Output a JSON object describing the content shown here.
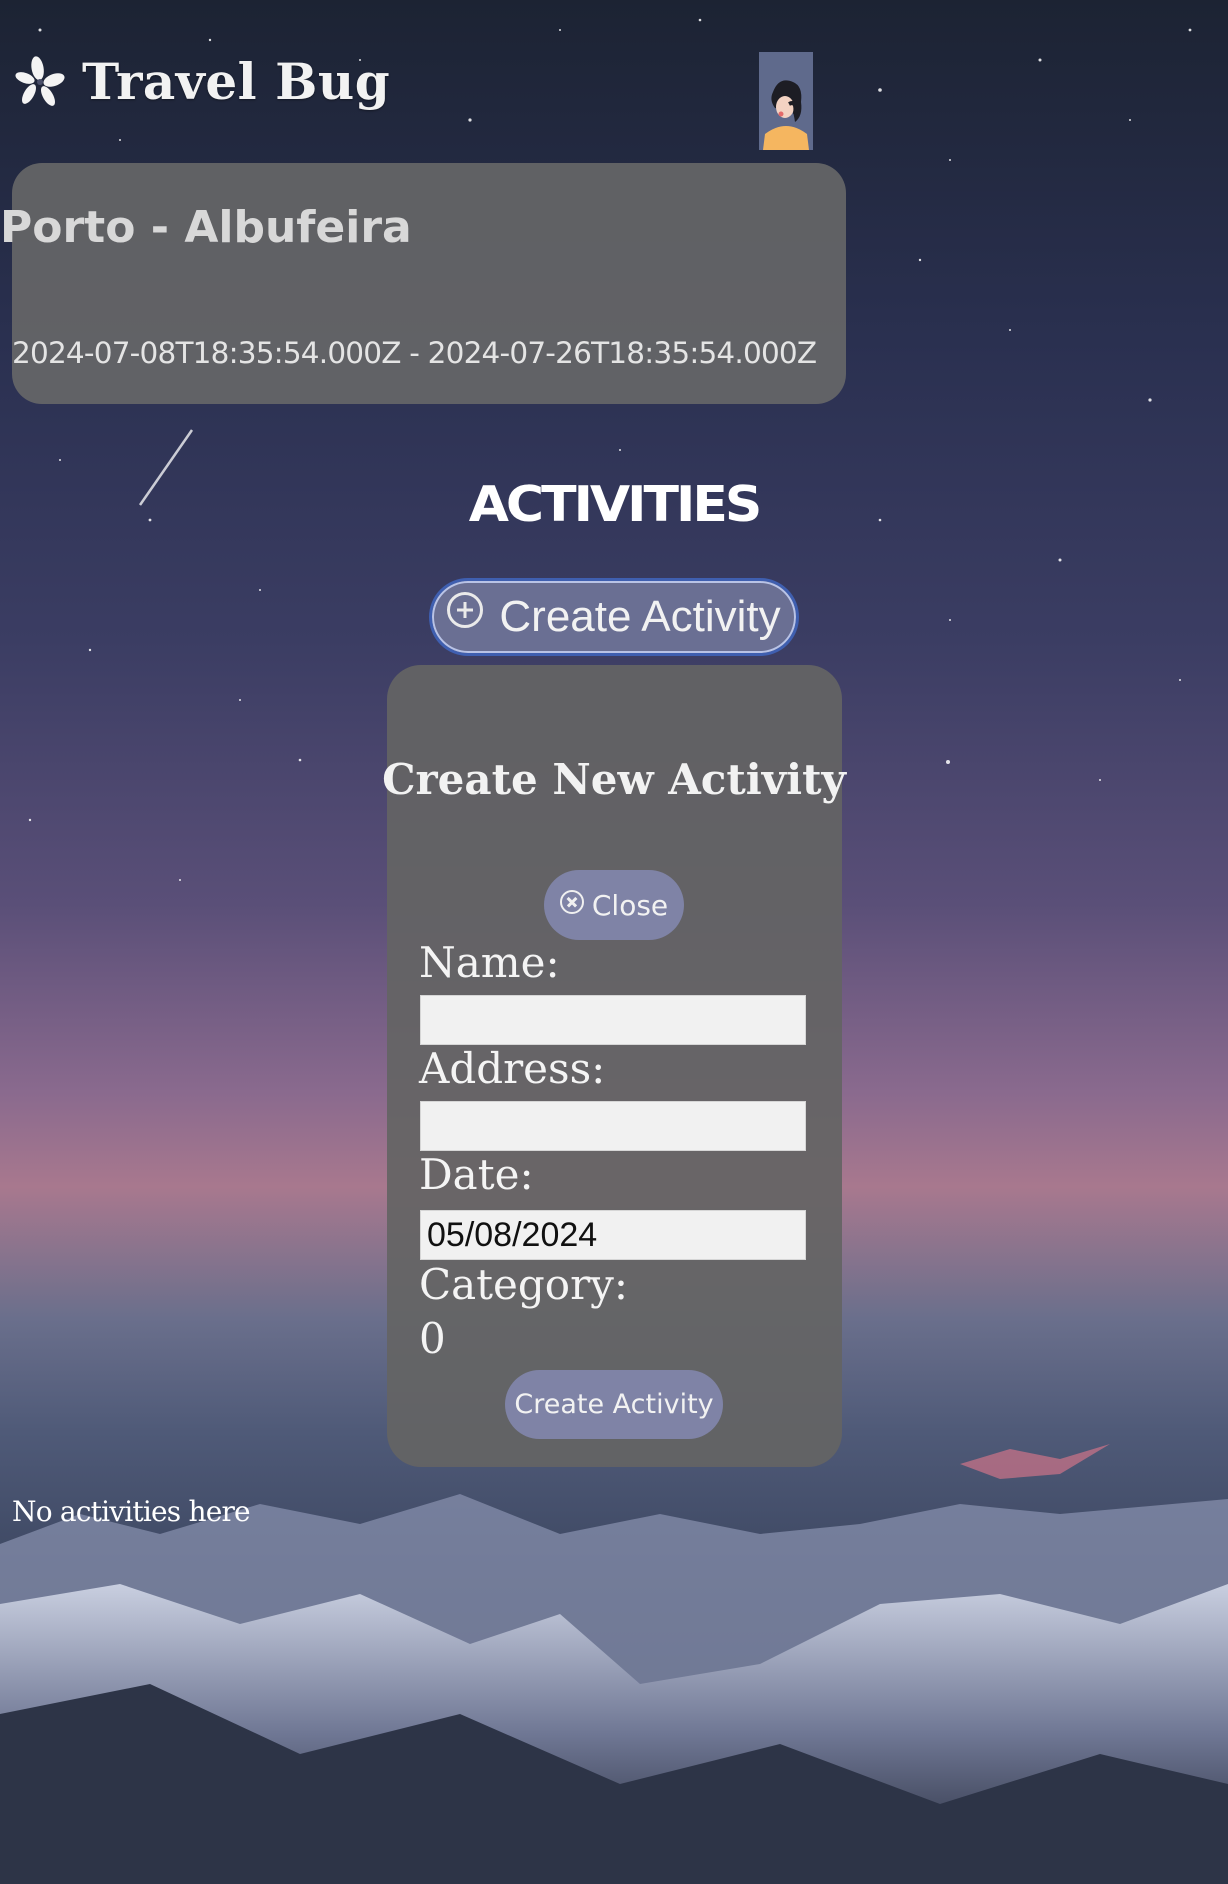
{
  "header": {
    "brand_title": "Travel Bug",
    "brand_icon": "flower-icon",
    "avatar_icon": "user-avatar"
  },
  "trip": {
    "title": "Porto - Albufeira",
    "dates": "2024-07-08T18:35:54.000Z - 2024-07-26T18:35:54.000Z"
  },
  "activities": {
    "heading": "ACTIVITIES",
    "create_button_label": "Create Activity",
    "empty_message": "No activities here"
  },
  "modal": {
    "title": "Create New Activity",
    "close_label": "Close",
    "name_label": "Name:",
    "name_value": "",
    "address_label": "Address:",
    "address_value": "",
    "date_label": "Date:",
    "date_value": "05/08/2024",
    "category_label": "Category:",
    "category_value": "0",
    "submit_label": "Create Activity"
  },
  "colors": {
    "button_bg": "#7f83a6",
    "card_bg": "#696969",
    "button_border": "#3f5fb0"
  }
}
